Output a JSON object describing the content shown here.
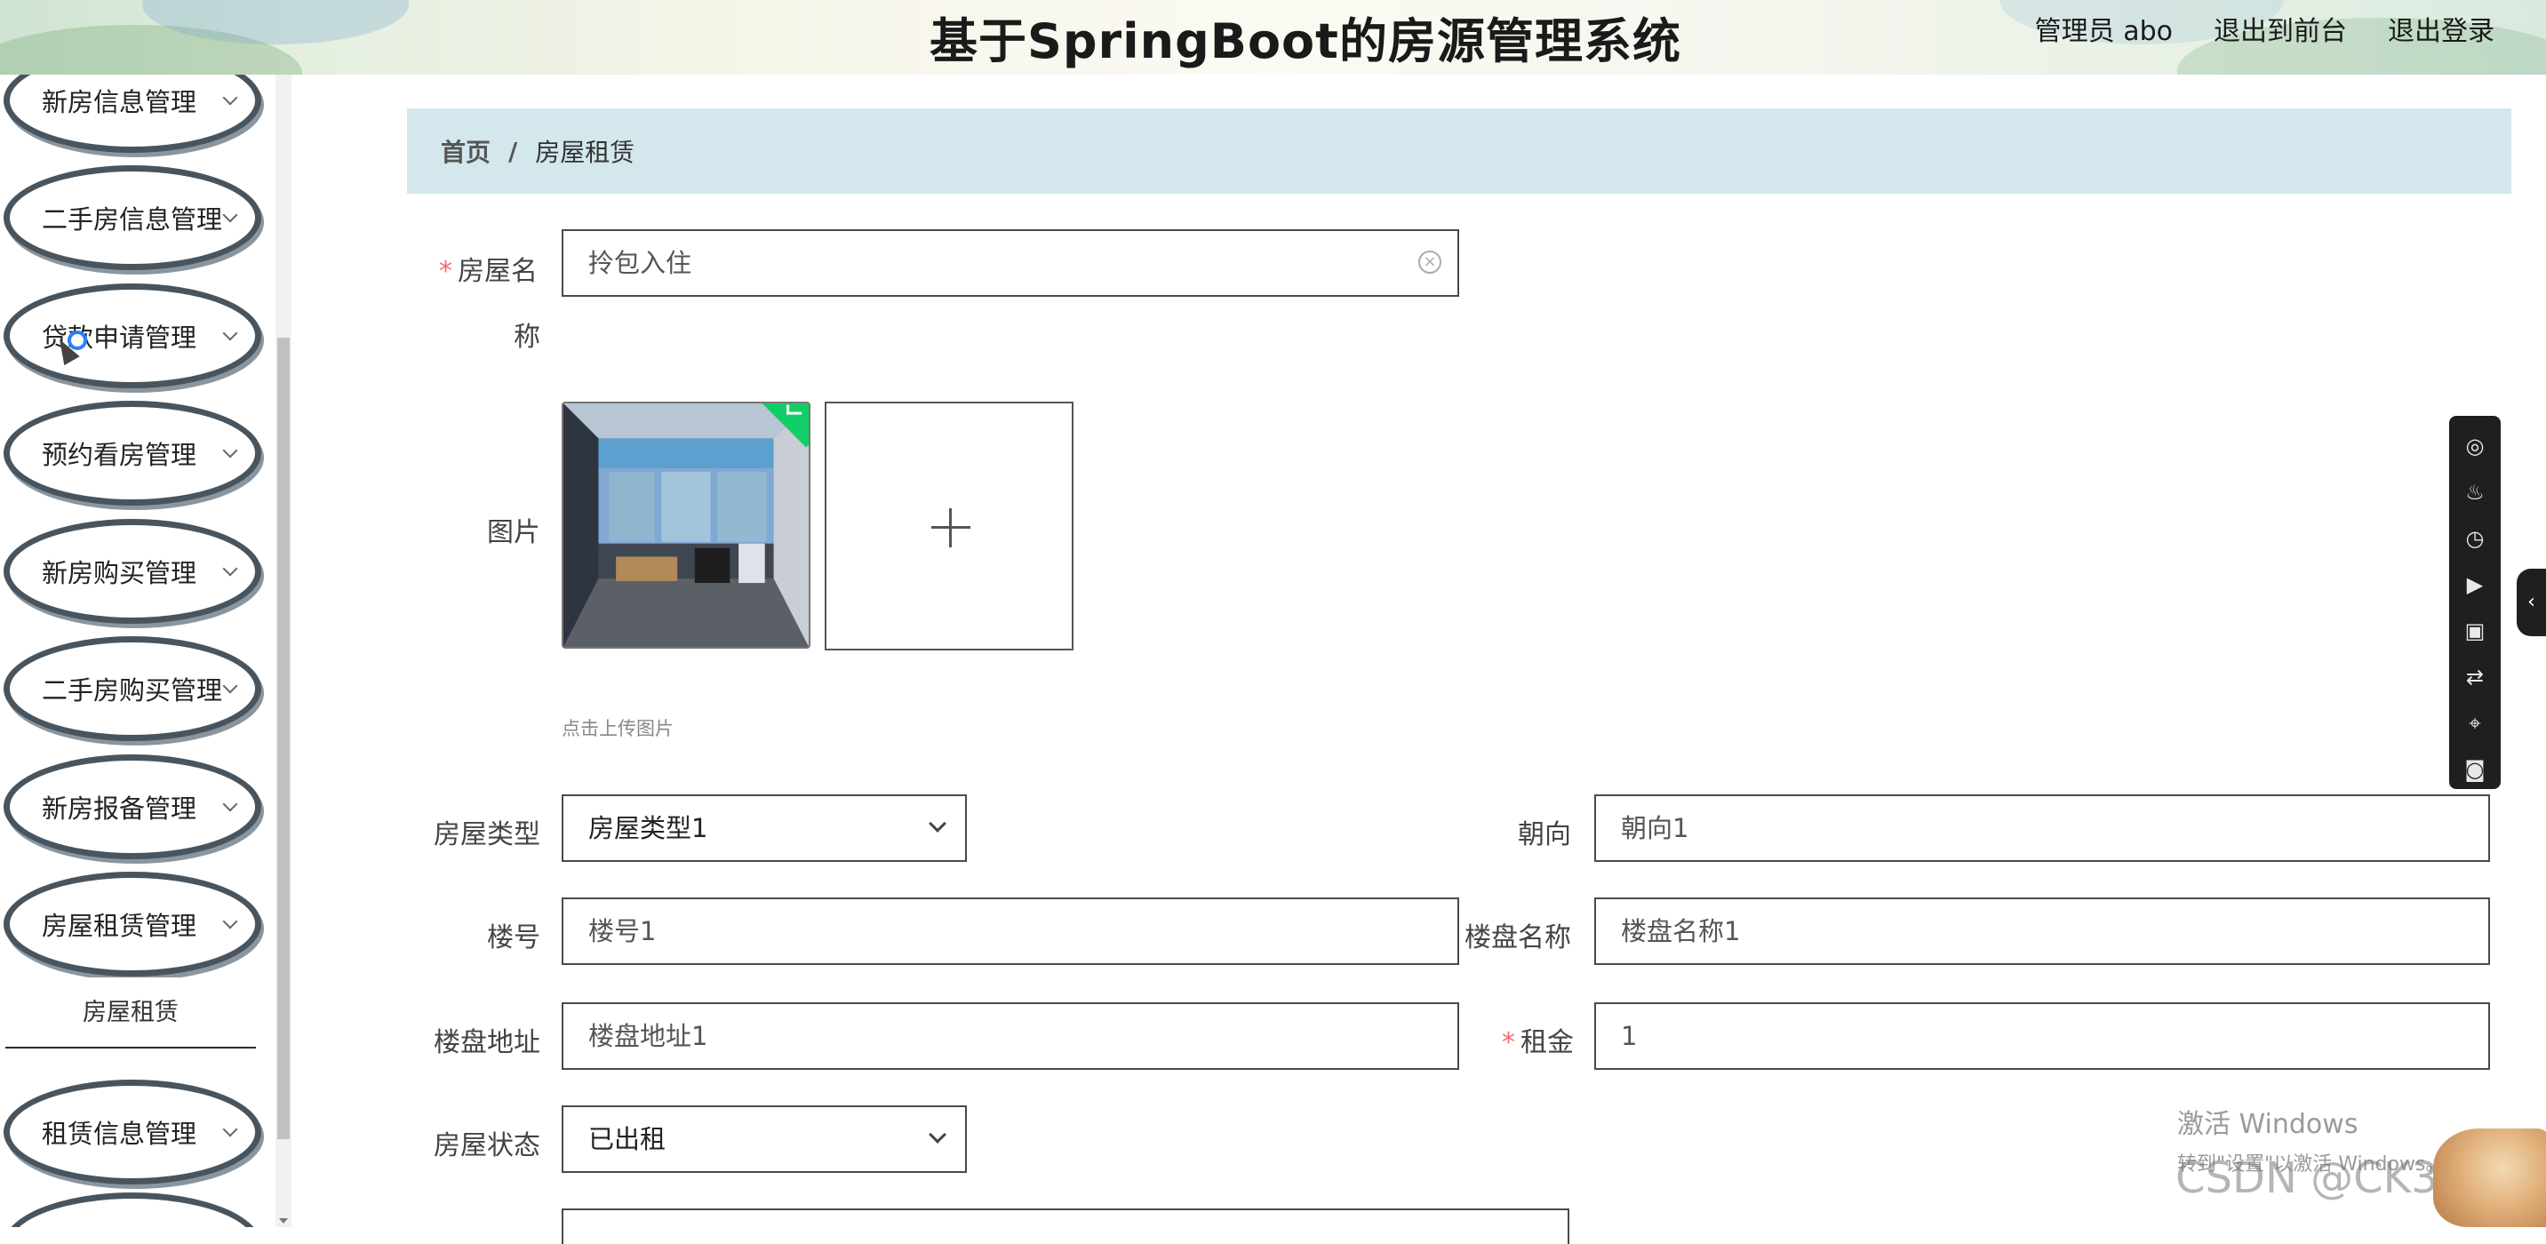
{
  "header": {
    "title": "基于SpringBoot的房源管理系统",
    "user": "管理员 abo",
    "front_link": "退出到前台",
    "logout": "退出登录"
  },
  "sidebar": {
    "items": [
      {
        "label": "新房信息管理"
      },
      {
        "label": "二手房信息管理"
      },
      {
        "label": "贷款申请管理"
      },
      {
        "label": "预约看房管理"
      },
      {
        "label": "新房购买管理"
      },
      {
        "label": "二手房购买管理"
      },
      {
        "label": "新房报备管理"
      },
      {
        "label": "房屋租赁管理"
      },
      {
        "label": "租赁信息管理"
      }
    ],
    "active_sub": "房屋租赁"
  },
  "breadcrumb": {
    "home": "首页",
    "separator": "/",
    "current": "房屋租赁"
  },
  "form": {
    "house_name": {
      "label_line1": "房屋名",
      "label_line2": "称",
      "value": "拎包入住"
    },
    "picture": {
      "label": "图片",
      "tip": "点击上传图片"
    },
    "house_type": {
      "label": "房屋类型",
      "value": "房屋类型1"
    },
    "orientation": {
      "label": "朝向",
      "value": "朝向1"
    },
    "building_no": {
      "label": "楼号",
      "value": "楼号1"
    },
    "estate_name": {
      "label": "楼盘名称",
      "value": "楼盘名称1"
    },
    "estate_address": {
      "label": "楼盘地址",
      "value": "楼盘地址1"
    },
    "rent": {
      "label": "租金",
      "value": "1"
    },
    "house_status": {
      "label": "房屋状态",
      "value": "已出租"
    },
    "required_mark": "*"
  },
  "float_toolbar": {
    "tools": [
      "◎",
      "♨",
      "◷",
      "▶",
      "▣",
      "⇄",
      "⌖",
      "◙"
    ],
    "collapse": "‹"
  },
  "watermarks": {
    "windows_line1": "激活 Windows",
    "windows_line2": "转到\"设置\"以激活 Windows。",
    "csdn": "CSDN @CK3039"
  },
  "colors": {
    "breadcrumb_bg": "#d3e7ec",
    "required": "#f56c6c",
    "upload_success": "#13ce66"
  }
}
